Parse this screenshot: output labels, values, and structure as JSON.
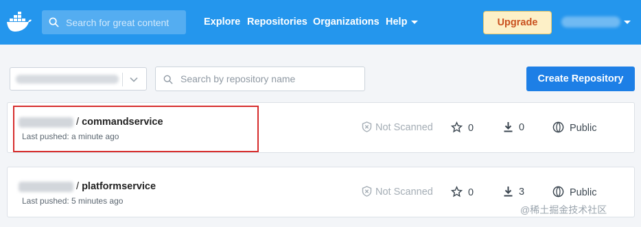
{
  "header": {
    "logo_icon": "docker-whale-icon",
    "search_placeholder": "Search for great content",
    "nav": [
      "Explore",
      "Repositories",
      "Organizations",
      "Help"
    ],
    "upgrade_label": "Upgrade",
    "colors": {
      "bar": "#2496ed",
      "upgrade_bg": "#fdf0c7",
      "upgrade_text": "#c9501e"
    }
  },
  "toolbar": {
    "namespace_value": "",
    "repo_search_placeholder": "Search by repository name",
    "create_label": "Create Repository",
    "create_color": "#1d7fe6"
  },
  "repositories": [
    {
      "name": "commandservice",
      "last_pushed": "Last pushed: a minute ago",
      "scan_status": "Not Scanned",
      "stars": "0",
      "pulls": "0",
      "visibility": "Public"
    },
    {
      "name": "platformservice",
      "last_pushed": "Last pushed: 5 minutes ago",
      "scan_status": "Not Scanned",
      "stars": "0",
      "pulls": "3",
      "visibility": "Public"
    }
  ],
  "watermark": "@稀土掘金技术社区"
}
